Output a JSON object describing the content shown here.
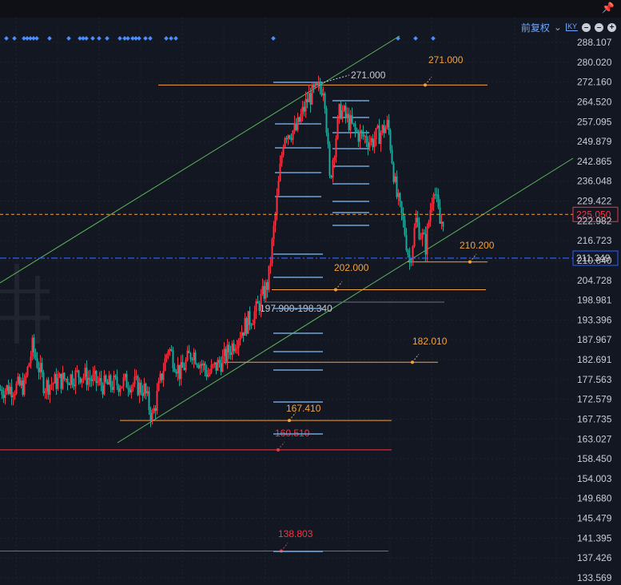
{
  "toolbar": {
    "adjustment_label": "前复权",
    "pin_icon": "pin-icon",
    "dropdown_icon": "chevron-down-icon",
    "ky_icon": "ky-icon",
    "zoom_out_icon": "minus-circle-icon",
    "zoom_in_icon": "plus-circle-icon"
  },
  "chart_data": {
    "type": "candlestick",
    "y_axis_ticks": [
      "288.107",
      "280.020",
      "272.160",
      "264.520",
      "257.095",
      "249.879",
      "242.865",
      "236.048",
      "229.422",
      "222.982",
      "216.723",
      "210.640",
      "204.728",
      "198.981",
      "193.396",
      "187.967",
      "182.691",
      "177.563",
      "172.579",
      "167.735",
      "163.027",
      "158.450",
      "154.003",
      "149.680",
      "145.479",
      "141.395",
      "137.426",
      "133.569"
    ],
    "y_range": [
      133.569,
      288.107
    ],
    "scale": "log",
    "current_price": {
      "value": 225.05,
      "label": "225.050",
      "color": "#f23645"
    },
    "crosshair_price": {
      "value": 211.349,
      "label": "211.349",
      "color": "#2962ff"
    },
    "horizontal_levels": [
      {
        "value": 271.0,
        "label": "271.000",
        "color": "#f7a23b"
      },
      {
        "value": 210.2,
        "label": "210.200",
        "color": "#f7a23b"
      },
      {
        "value": 202.0,
        "label": "202.000",
        "color": "#f7a23b"
      },
      {
        "value": 182.01,
        "label": "182.010",
        "color": "#f7a23b"
      },
      {
        "value": 167.41,
        "label": "167.410",
        "color": "#f7a23b"
      },
      {
        "value": 160.51,
        "label": "160.510",
        "color": "#f23645"
      },
      {
        "value": 138.803,
        "label": "138.803",
        "color": "#f23645"
      }
    ],
    "annotations": [
      {
        "label": "271.000",
        "value": 271.0
      },
      {
        "label": "197.900-198.340",
        "value": 198.34
      }
    ],
    "channel_lines": [
      {
        "name": "",
        "color": "#5cb85c"
      },
      {
        "name": "",
        "color": "#5cb85c"
      }
    ],
    "ohlc_trend": [
      {
        "i": 0,
        "close": 175
      },
      {
        "i": 30,
        "close": 176
      },
      {
        "i": 40,
        "close": 186
      },
      {
        "i": 55,
        "close": 176
      },
      {
        "i": 70,
        "close": 177
      },
      {
        "i": 100,
        "close": 179
      },
      {
        "i": 130,
        "close": 176
      },
      {
        "i": 160,
        "close": 177
      },
      {
        "i": 180,
        "close": 175
      },
      {
        "i": 190,
        "close": 168
      },
      {
        "i": 210,
        "close": 186
      },
      {
        "i": 225,
        "close": 179
      },
      {
        "i": 240,
        "close": 185
      },
      {
        "i": 260,
        "close": 179
      },
      {
        "i": 280,
        "close": 183
      },
      {
        "i": 300,
        "close": 190
      },
      {
        "i": 320,
        "close": 196
      },
      {
        "i": 335,
        "close": 204
      },
      {
        "i": 345,
        "close": 227
      },
      {
        "i": 355,
        "close": 253
      },
      {
        "i": 370,
        "close": 254
      },
      {
        "i": 385,
        "close": 266
      },
      {
        "i": 405,
        "close": 271
      },
      {
        "i": 412,
        "close": 236
      },
      {
        "i": 425,
        "close": 262
      },
      {
        "i": 445,
        "close": 253
      },
      {
        "i": 465,
        "close": 250
      },
      {
        "i": 485,
        "close": 256
      },
      {
        "i": 495,
        "close": 232
      },
      {
        "i": 505,
        "close": 221
      },
      {
        "i": 512,
        "close": 210.2
      },
      {
        "i": 520,
        "close": 223
      },
      {
        "i": 532,
        "close": 215
      },
      {
        "i": 542,
        "close": 235
      },
      {
        "i": 550,
        "close": 222
      },
      {
        "i": 556,
        "close": 225
      }
    ]
  }
}
